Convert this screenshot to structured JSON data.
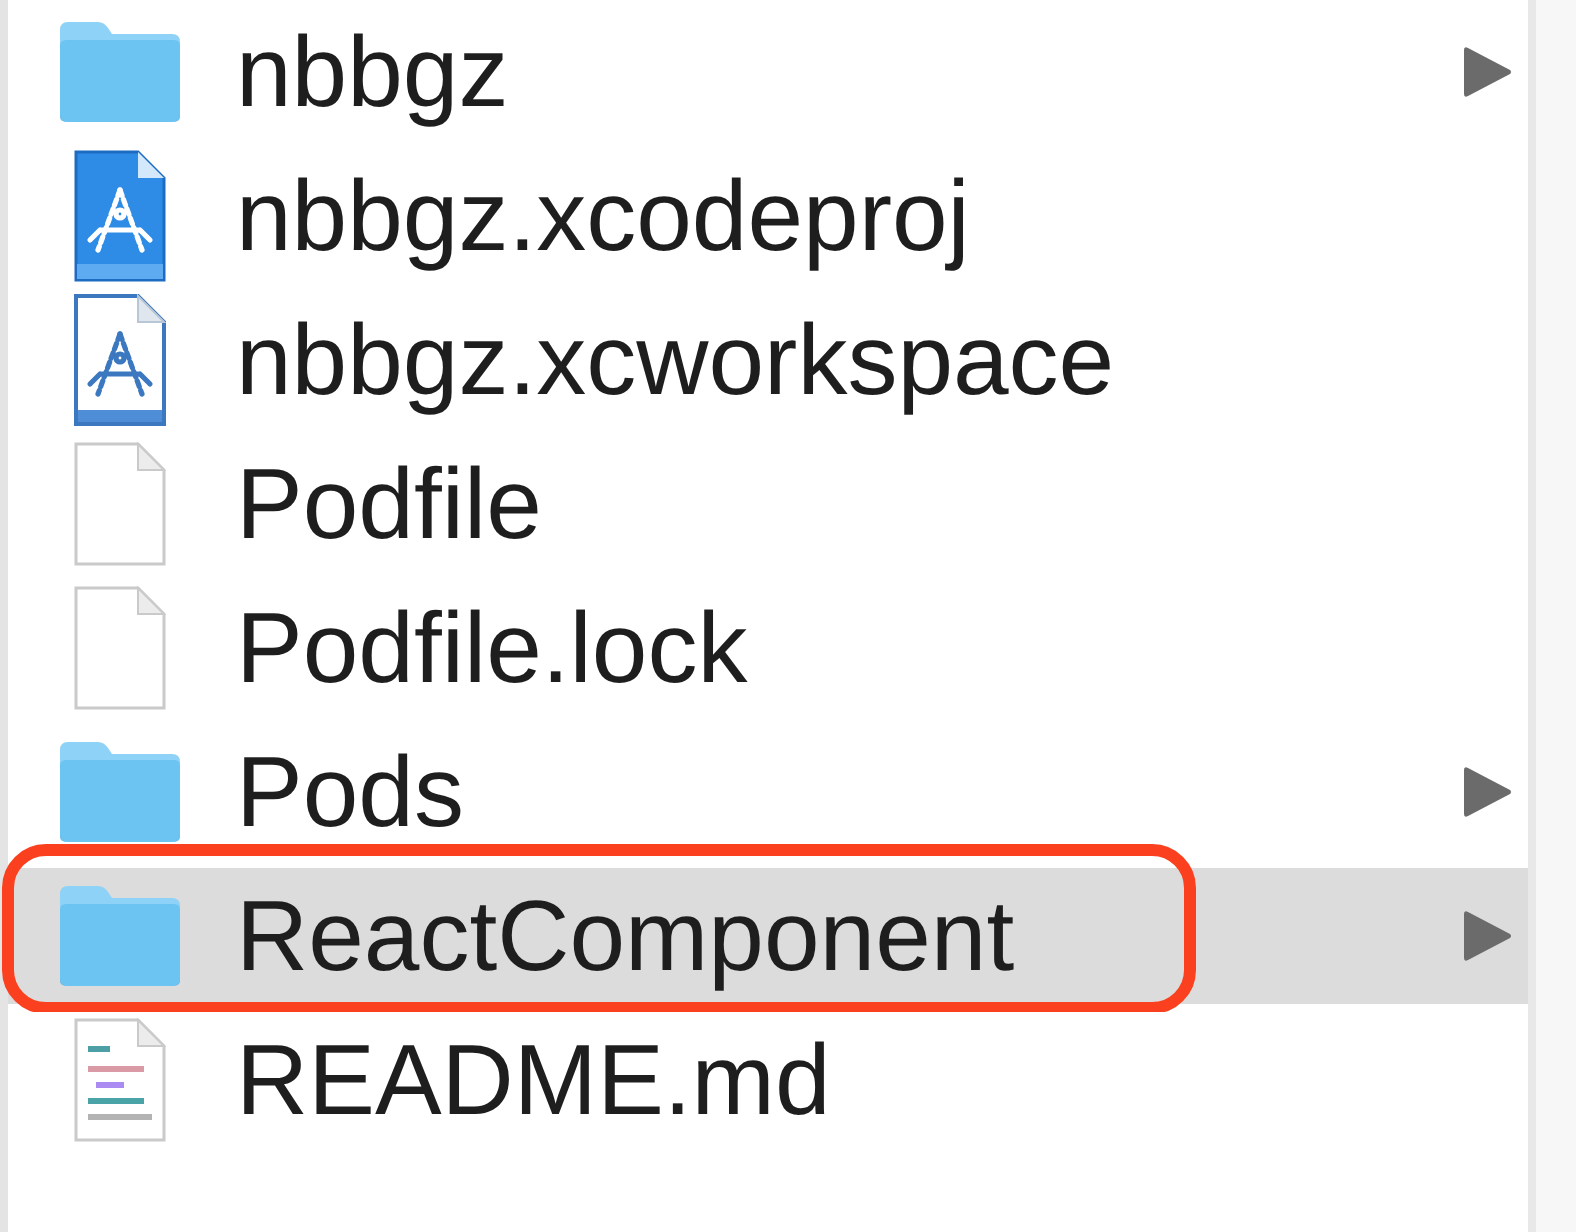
{
  "column": {
    "items": [
      {
        "name": "nbbgz",
        "kind": "folder",
        "selected": false,
        "outlined": false
      },
      {
        "name": "nbbgz.xcodeproj",
        "kind": "xcodeproj",
        "selected": false,
        "outlined": false
      },
      {
        "name": "nbbgz.xcworkspace",
        "kind": "xcworkspace",
        "selected": false,
        "outlined": false
      },
      {
        "name": "Podfile",
        "kind": "file",
        "selected": false,
        "outlined": false
      },
      {
        "name": "Podfile.lock",
        "kind": "file",
        "selected": false,
        "outlined": false
      },
      {
        "name": "Pods",
        "kind": "folder",
        "selected": false,
        "outlined": false
      },
      {
        "name": "ReactComponent",
        "kind": "folder",
        "selected": true,
        "outlined": true
      },
      {
        "name": "README.md",
        "kind": "markdown",
        "selected": false,
        "outlined": false
      }
    ]
  }
}
